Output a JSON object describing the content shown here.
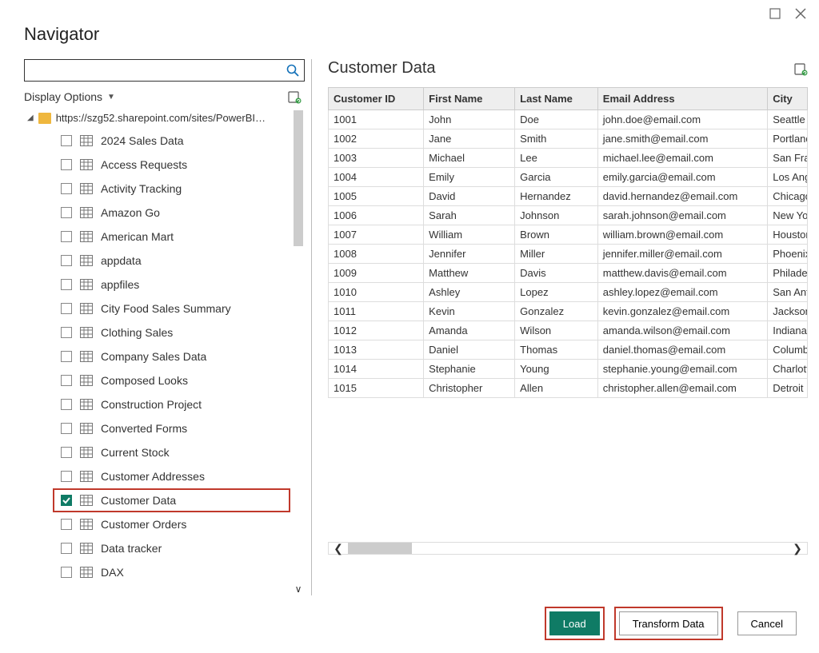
{
  "title": "Navigator",
  "display_options": "Display Options",
  "tree_root": "https://szg52.sharepoint.com/sites/PowerBI…",
  "tree_items": [
    {
      "label": "2024 Sales Data",
      "checked": false
    },
    {
      "label": "Access Requests",
      "checked": false
    },
    {
      "label": "Activity Tracking",
      "checked": false
    },
    {
      "label": "Amazon Go",
      "checked": false
    },
    {
      "label": "American Mart",
      "checked": false
    },
    {
      "label": "appdata",
      "checked": false
    },
    {
      "label": "appfiles",
      "checked": false
    },
    {
      "label": "City Food Sales Summary",
      "checked": false
    },
    {
      "label": "Clothing Sales",
      "checked": false
    },
    {
      "label": "Company Sales Data",
      "checked": false
    },
    {
      "label": "Composed Looks",
      "checked": false
    },
    {
      "label": "Construction Project",
      "checked": false
    },
    {
      "label": "Converted Forms",
      "checked": false
    },
    {
      "label": "Current Stock",
      "checked": false
    },
    {
      "label": "Customer Addresses",
      "checked": false
    },
    {
      "label": "Customer Data",
      "checked": true
    },
    {
      "label": "Customer Orders",
      "checked": false
    },
    {
      "label": "Data tracker",
      "checked": false
    },
    {
      "label": "DAX",
      "checked": false
    }
  ],
  "preview_title": "Customer Data",
  "columns": [
    "Customer ID",
    "First Name",
    "Last Name",
    "Email Address",
    "City"
  ],
  "rows": [
    [
      "1001",
      "John",
      "Doe",
      "john.doe@email.com",
      "Seattle"
    ],
    [
      "1002",
      "Jane",
      "Smith",
      "jane.smith@email.com",
      "Portland"
    ],
    [
      "1003",
      "Michael",
      "Lee",
      "michael.lee@email.com",
      "San Francisco"
    ],
    [
      "1004",
      "Emily",
      "Garcia",
      "emily.garcia@email.com",
      "Los Angeles"
    ],
    [
      "1005",
      "David",
      "Hernandez",
      "david.hernandez@email.com",
      "Chicago"
    ],
    [
      "1006",
      "Sarah",
      "Johnson",
      "sarah.johnson@email.com",
      "New York"
    ],
    [
      "1007",
      "William",
      "Brown",
      "william.brown@email.com",
      "Houston"
    ],
    [
      "1008",
      "Jennifer",
      "Miller",
      "jennifer.miller@email.com",
      "Phoenix"
    ],
    [
      "1009",
      "Matthew",
      "Davis",
      "matthew.davis@email.com",
      "Philadelphia"
    ],
    [
      "1010",
      "Ashley",
      "Lopez",
      "ashley.lopez@email.com",
      "San Antonio"
    ],
    [
      "1011",
      "Kevin",
      "Gonzalez",
      "kevin.gonzalez@email.com",
      "Jacksonville"
    ],
    [
      "1012",
      "Amanda",
      "Wilson",
      "amanda.wilson@email.com",
      "Indianapolis"
    ],
    [
      "1013",
      "Daniel",
      "Thomas",
      "daniel.thomas@email.com",
      "Columbus"
    ],
    [
      "1014",
      "Stephanie",
      "Young",
      "stephanie.young@email.com",
      "Charlotte"
    ],
    [
      "1015",
      "Christopher",
      "Allen",
      "christopher.allen@email.com",
      "Detroit"
    ]
  ],
  "buttons": {
    "load": "Load",
    "transform": "Transform Data",
    "cancel": "Cancel"
  }
}
